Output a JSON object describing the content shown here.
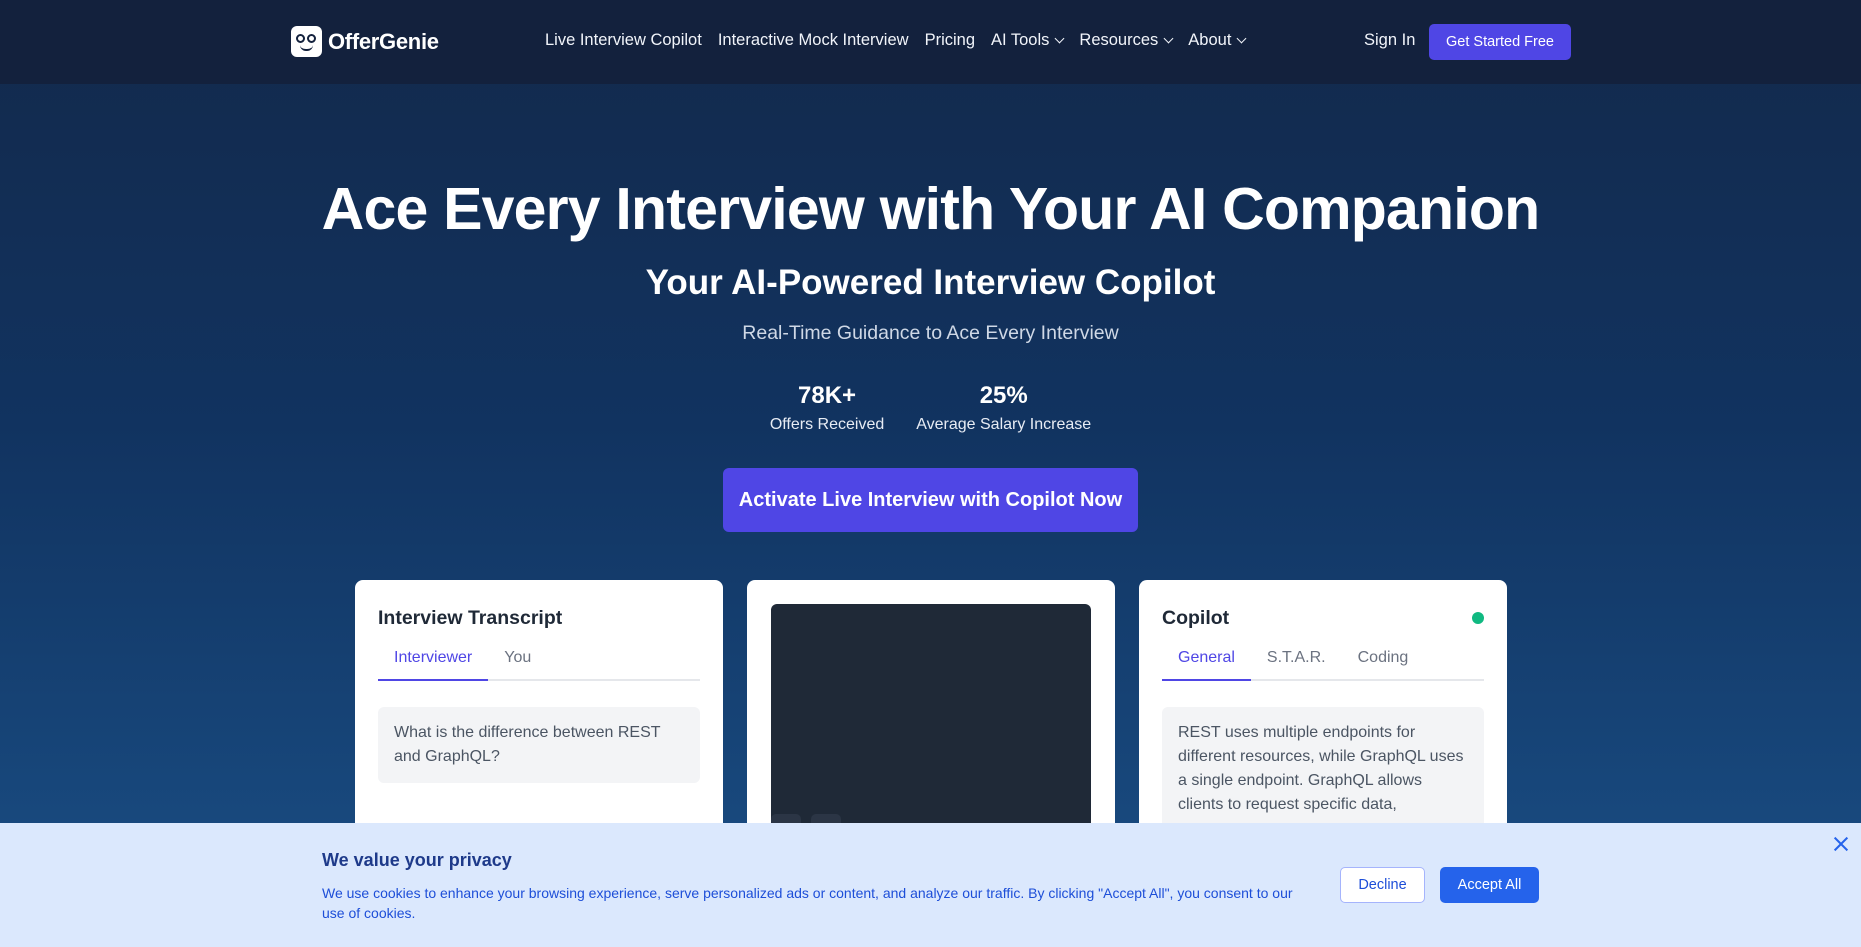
{
  "nav": {
    "brand": "OfferGenie",
    "links": [
      {
        "label": "Live Interview Copilot",
        "dropdown": false
      },
      {
        "label": "Interactive Mock Interview",
        "dropdown": false
      },
      {
        "label": "Pricing",
        "dropdown": false
      },
      {
        "label": "AI Tools",
        "dropdown": true
      },
      {
        "label": "Resources",
        "dropdown": true
      },
      {
        "label": "About",
        "dropdown": true
      }
    ],
    "sign_in": "Sign In",
    "get_started": "Get Started Free"
  },
  "hero": {
    "title": "Ace Every Interview with Your AI Companion",
    "subtitle": "Your AI-Powered Interview Copilot",
    "tagline": "Real-Time Guidance to Ace Every Interview",
    "stats": [
      {
        "value": "78K+",
        "label": "Offers Received"
      },
      {
        "value": "25%",
        "label": "Average Salary Increase"
      }
    ],
    "cta": "Activate Live Interview with Copilot Now"
  },
  "transcript_card": {
    "title": "Interview Transcript",
    "tabs": [
      "Interviewer",
      "You"
    ],
    "active_tab": "Interviewer",
    "message": "What is the difference between REST and GraphQL?"
  },
  "copilot_card": {
    "title": "Copilot",
    "status_color": "#10b981",
    "tabs": [
      "General",
      "S.T.A.R.",
      "Coding"
    ],
    "active_tab": "General",
    "message": "REST uses multiple endpoints for different resources, while GraphQL uses a single endpoint. GraphQL allows clients to request specific data,"
  },
  "cookie": {
    "title": "We value your privacy",
    "text": "We use cookies to enhance your browsing experience, serve personalized ads or content, and analyze our traffic. By clicking \"Accept All\", you consent to our use of cookies.",
    "decline": "Decline",
    "accept": "Accept All"
  },
  "colors": {
    "accent": "#4f46e5",
    "nav_bg": "#13213d",
    "cookie_bg": "#dbe8fd",
    "cookie_button": "#2563eb"
  }
}
